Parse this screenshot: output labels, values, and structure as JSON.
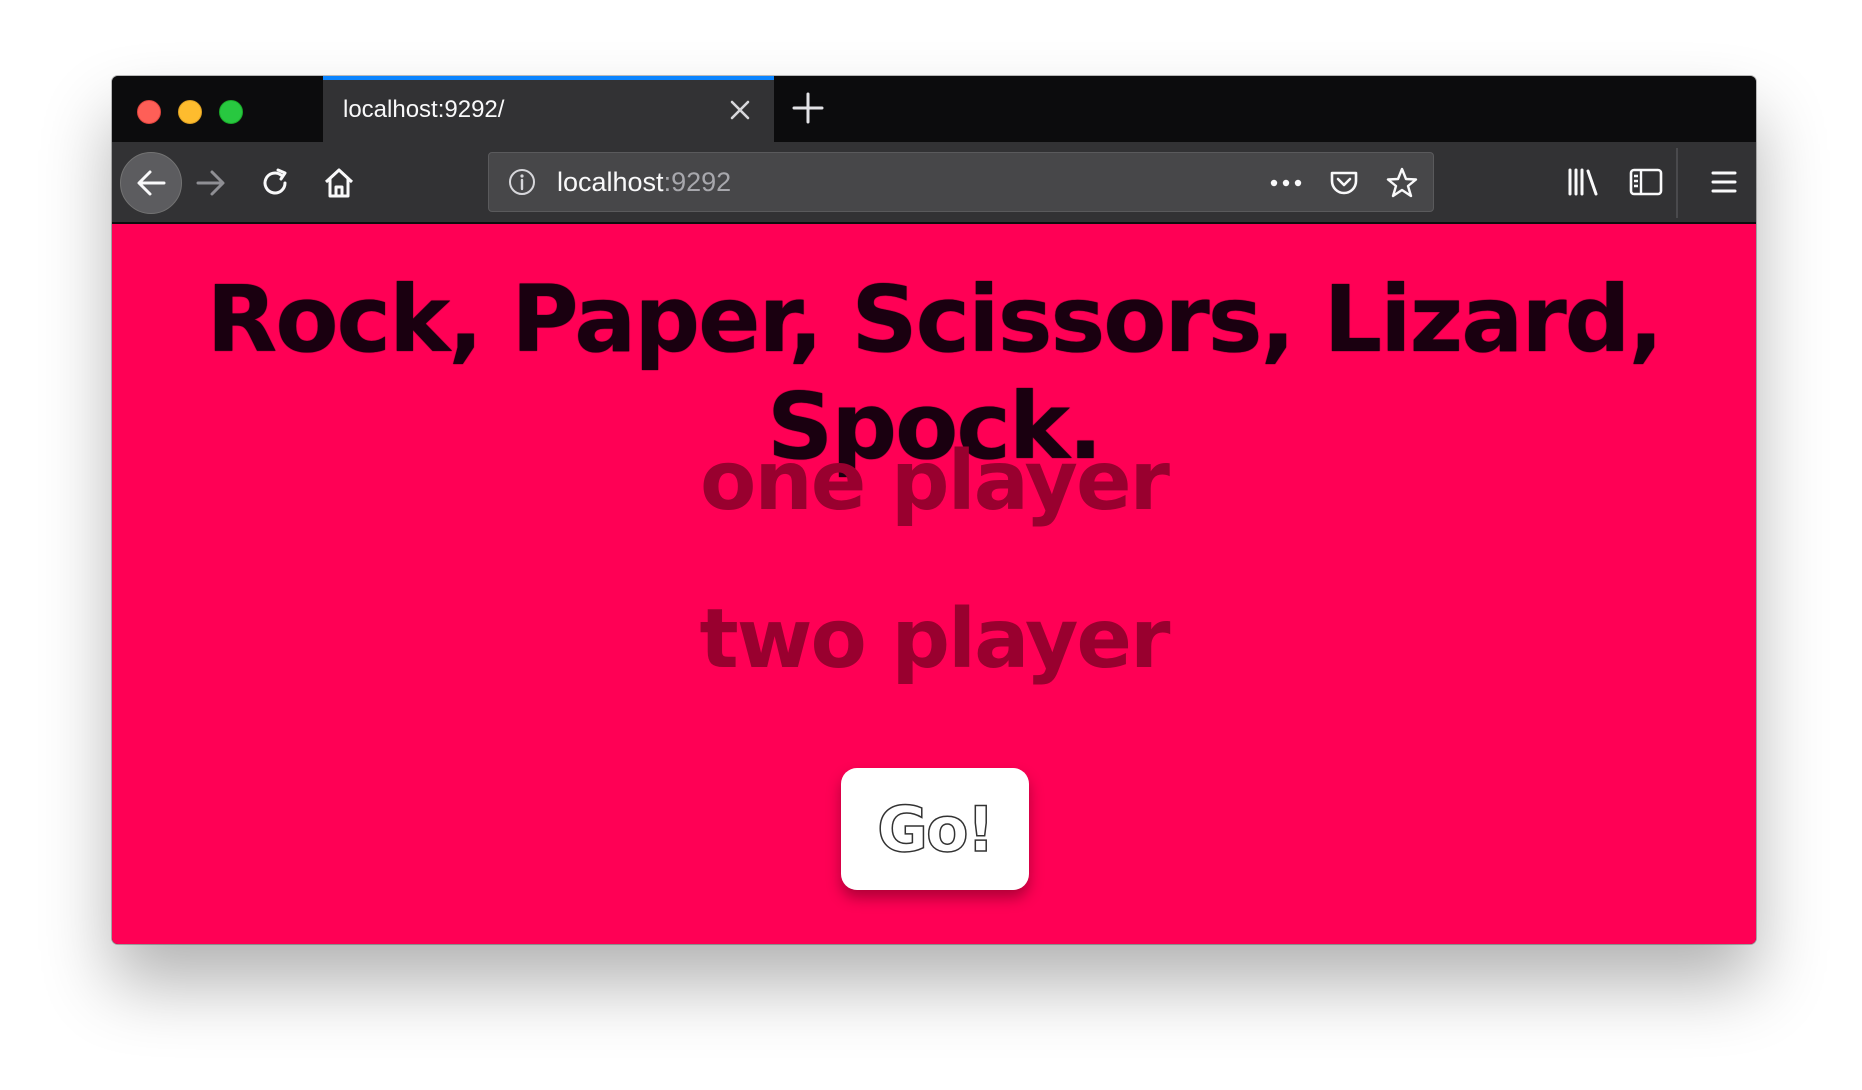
{
  "browser": {
    "tab": {
      "title": "localhost:9292/",
      "close_icon": "close-icon"
    },
    "new_tab_icon": "plus-icon",
    "nav": {
      "back_icon": "arrow-left-icon",
      "forward_icon": "arrow-right-icon",
      "reload_icon": "reload-icon",
      "home_icon": "home-icon"
    },
    "urlbar": {
      "info_icon": "info-icon",
      "host": "localhost",
      "port": ":9292",
      "actions": [
        "more-icon",
        "pocket-icon",
        "star-icon"
      ]
    },
    "toolbar": [
      "library-icon",
      "sidebar-icon",
      "hamburger-menu-icon"
    ],
    "accent_color": "#0a84ff"
  },
  "page": {
    "background_color": "#ff0055",
    "title": "Rock, Paper, Scissors, Lizard, Spock.",
    "options": [
      {
        "label": "one player"
      },
      {
        "label": "two player"
      }
    ],
    "go_button": {
      "label": "Go!"
    }
  }
}
